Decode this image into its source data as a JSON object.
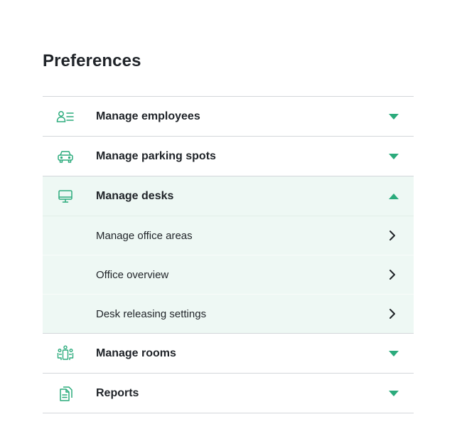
{
  "page": {
    "title": "Preferences"
  },
  "colors": {
    "accent": "#2bab7c",
    "expanded_bg": "#eef8f4",
    "divider": "#d3d6da"
  },
  "menu": {
    "items": [
      {
        "label": "Manage employees",
        "icon": "employees-icon",
        "state": "collapsed"
      },
      {
        "label": "Manage parking spots",
        "icon": "car-icon",
        "state": "collapsed"
      },
      {
        "label": "Manage desks",
        "icon": "monitor-icon",
        "state": "expanded",
        "subitems": [
          {
            "label": "Manage office areas"
          },
          {
            "label": "Office overview"
          },
          {
            "label": "Desk releasing settings"
          }
        ]
      },
      {
        "label": "Manage rooms",
        "icon": "meeting-room-icon",
        "state": "collapsed"
      },
      {
        "label": "Reports",
        "icon": "report-document-icon",
        "state": "collapsed"
      }
    ]
  }
}
